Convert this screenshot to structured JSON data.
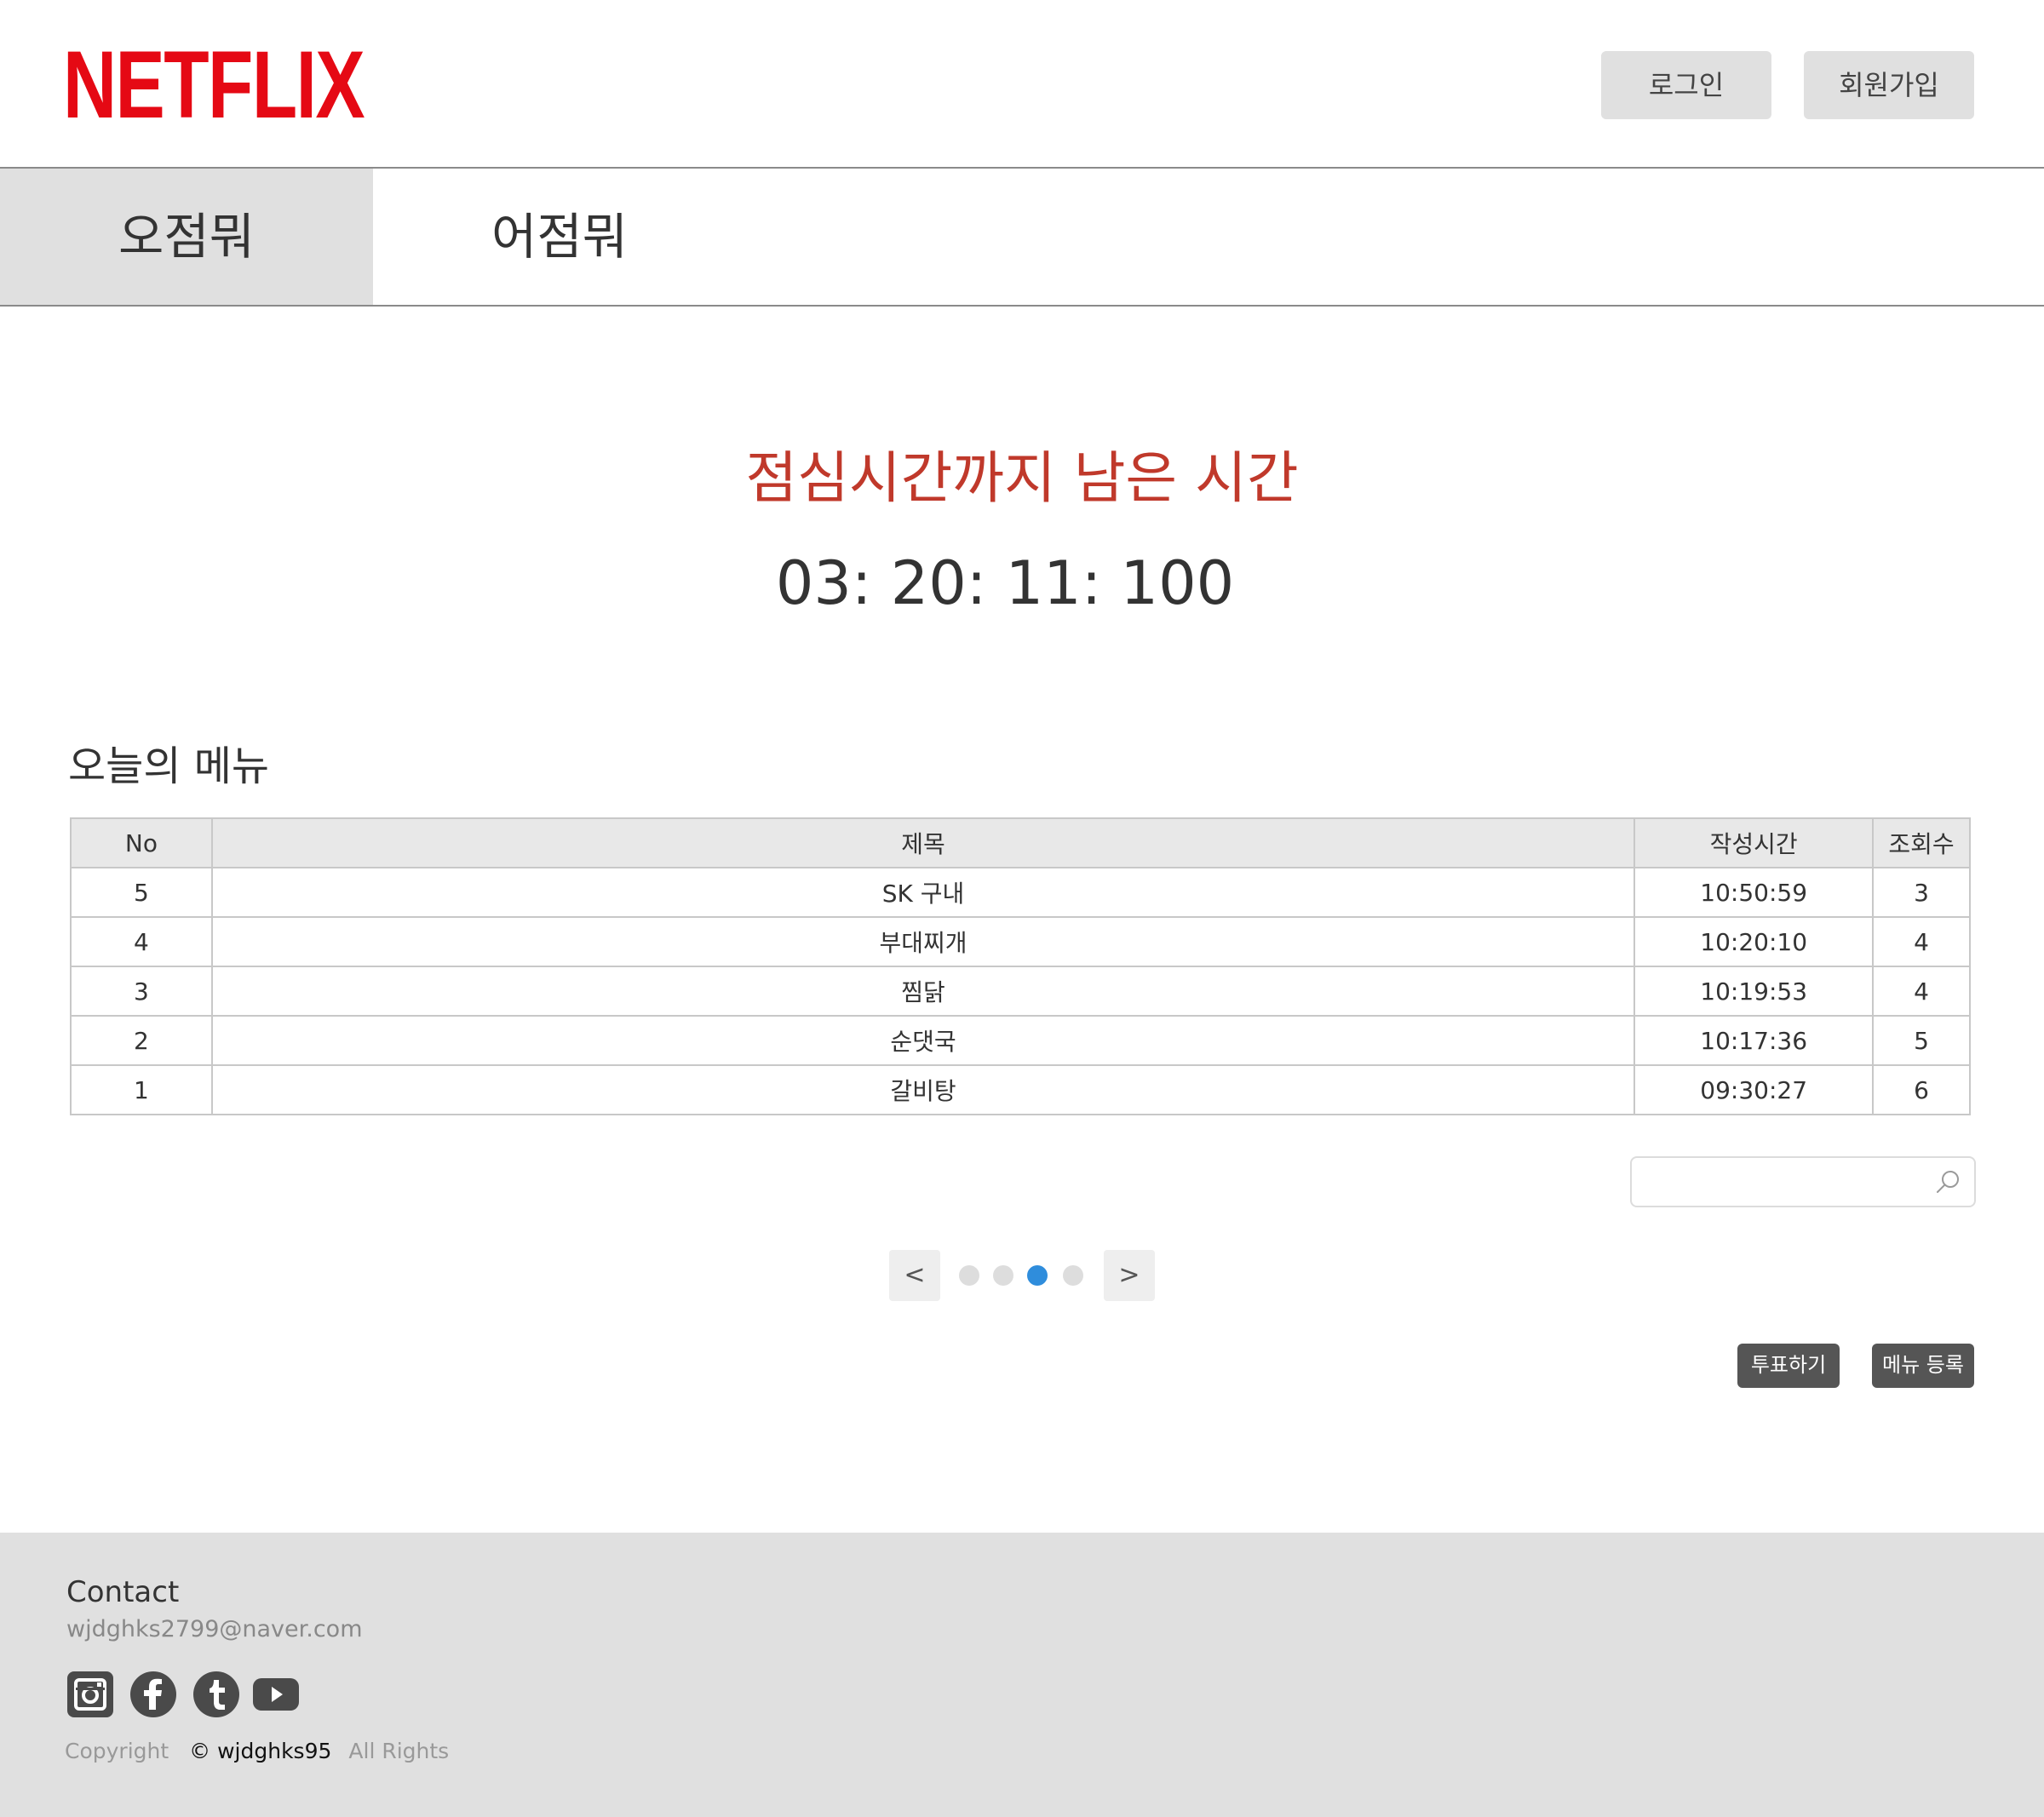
{
  "header": {
    "logo": "NETFLIX",
    "login_label": "로그인",
    "signup_label": "회원가입"
  },
  "tabs": [
    {
      "label": "오점뭐",
      "active": true
    },
    {
      "label": "어점뭐",
      "active": false
    }
  ],
  "countdown": {
    "title": "점심시간까지 남은 시간",
    "time": "03: 20: 11: 100"
  },
  "menu": {
    "heading": "오늘의 메뉴",
    "columns": [
      "No",
      "제목",
      "작성시간",
      "조회수"
    ],
    "rows": [
      {
        "no": "5",
        "title": "SK 구내",
        "time": "10:50:59",
        "views": "3"
      },
      {
        "no": "4",
        "title": "부대찌개",
        "time": "10:20:10",
        "views": "4"
      },
      {
        "no": "3",
        "title": "찜닭",
        "time": "10:19:53",
        "views": "4"
      },
      {
        "no": "2",
        "title": "순댓국",
        "time": "10:17:36",
        "views": "5"
      },
      {
        "no": "1",
        "title": "갈비탕",
        "time": "09:30:27",
        "views": "6"
      }
    ]
  },
  "search": {
    "value": "",
    "icon": "search-icon"
  },
  "pagination": {
    "prev_label": "<",
    "next_label": ">",
    "dots": 4,
    "active_dot": 3
  },
  "actions": {
    "vote_label": "투표하기",
    "register_label": "메뉴 등록"
  },
  "footer": {
    "contact_label": "Contact",
    "email": "wjdghks2799@naver.com",
    "social_icons": [
      "instagram-icon",
      "facebook-icon",
      "tumblr-icon",
      "youtube-icon"
    ],
    "copyright_label": "Copyright",
    "copyright_holder": "© wjdghks95",
    "rights_label": "All Rights"
  },
  "colors": {
    "brand": "#e50914",
    "countdown_title": "#c0392b",
    "active_dot": "#2f8ddc",
    "action_button": "#555555",
    "footer_bg": "#e0e0e0"
  }
}
